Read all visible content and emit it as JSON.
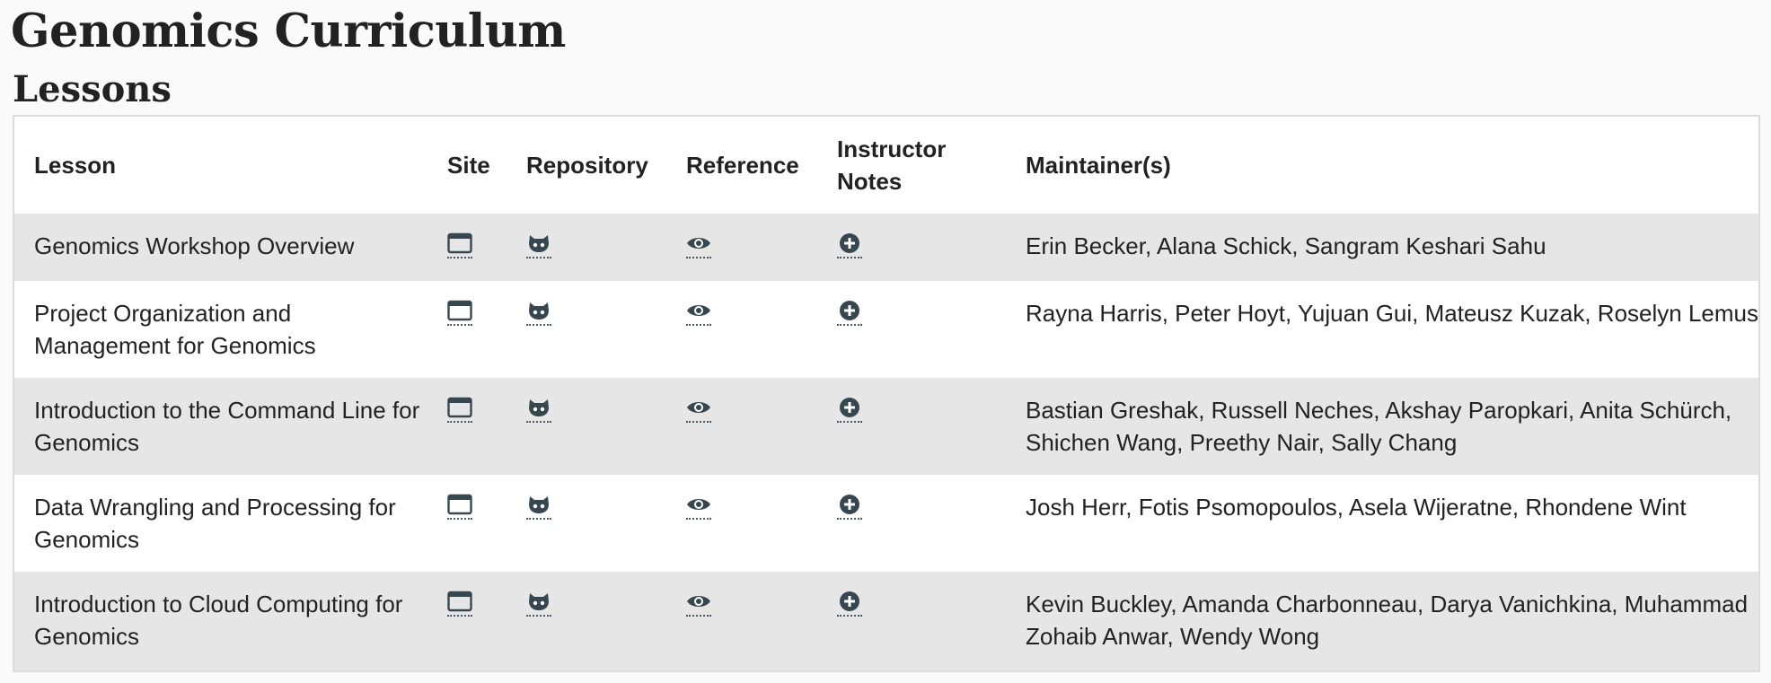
{
  "page": {
    "title": "Genomics Curriculum",
    "section_title": "Lessons"
  },
  "table": {
    "headers": {
      "lesson": "Lesson",
      "site": "Site",
      "repository": "Repository",
      "reference": "Reference",
      "instructor_notes": "Instructor Notes",
      "maintainers": "Maintainer(s)"
    },
    "rows": [
      {
        "lesson": "Genomics Workshop Overview",
        "maintainers": "Erin Becker, Alana Schick, Sangram Keshari Sahu"
      },
      {
        "lesson": "Project Organization and Management for Genomics",
        "maintainers": "Rayna Harris, Peter Hoyt, Yujuan Gui, Mateusz Kuzak, Roselyn Lemus"
      },
      {
        "lesson": "Introduction to the Command Line for Genomics",
        "maintainers": "Bastian Greshak, Russell Neches, Akshay Paropkari, Anita Schürch, Shichen Wang, Preethy Nair, Sally Chang"
      },
      {
        "lesson": "Data Wrangling and Processing for Genomics",
        "maintainers": "Josh Herr, Fotis Psomopoulos, Asela Wijeratne, Rhondene Wint"
      },
      {
        "lesson": "Introduction to Cloud Computing for Genomics",
        "maintainers": "Kevin Buckley, Amanda Charbonneau, Darya Vanichkina, Muhammad Zohaib Anwar, Wendy Wong"
      }
    ],
    "row_icons": {
      "site": "browser-window-icon",
      "repository": "github-octocat-icon",
      "reference": "eye-icon",
      "instructor_notes": "plus-circle-icon"
    }
  },
  "colors": {
    "text": "#222222",
    "icon": "#37474f",
    "stripe": "#e6e6e6",
    "border": "#dcdcdc"
  }
}
